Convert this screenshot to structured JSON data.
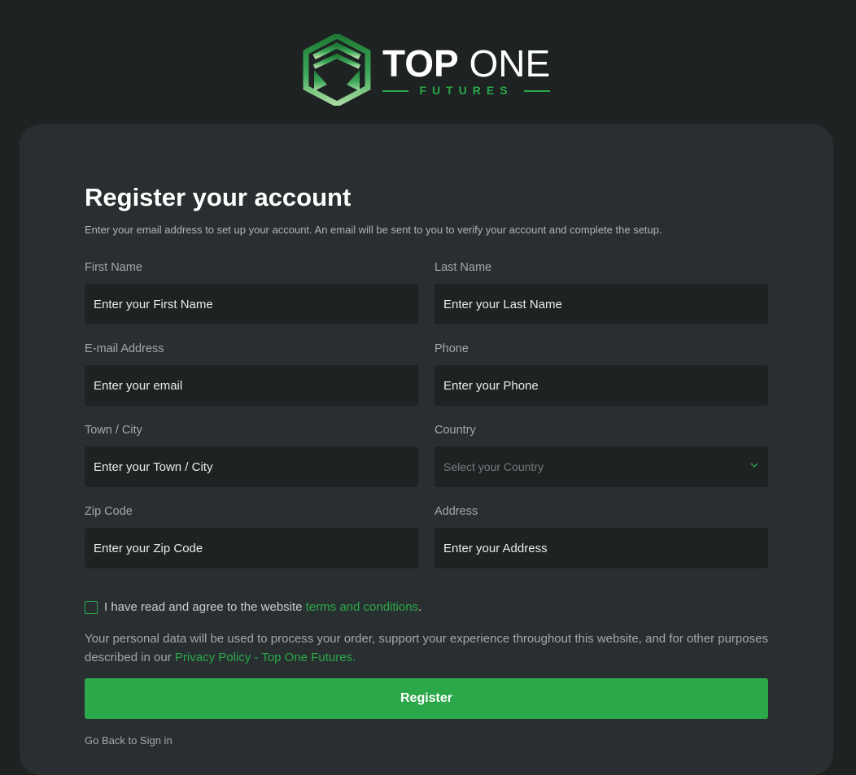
{
  "brand": {
    "name_bold": "TOP",
    "name_light": "ONE",
    "subtitle": "FUTURES",
    "logo_icon": "hexagon-logo-icon",
    "accent_color": "#2ba84a"
  },
  "form": {
    "title": "Register your account",
    "subtitle": "Enter your email address to set up your account. An email will be sent to you to verify your account and complete the setup.",
    "fields": {
      "first_name": {
        "label": "First Name",
        "placeholder": "Enter your First Name"
      },
      "last_name": {
        "label": "Last Name",
        "placeholder": "Enter your Last Name"
      },
      "email": {
        "label": "E-mail Address",
        "placeholder": "Enter your email"
      },
      "phone": {
        "label": "Phone",
        "placeholder": "Enter your Phone"
      },
      "town_city": {
        "label": "Town / City",
        "placeholder": "Enter your Town / City"
      },
      "country": {
        "label": "Country",
        "placeholder": "Select your Country",
        "icon": "chevron-down-icon"
      },
      "zip_code": {
        "label": "Zip Code",
        "placeholder": "Enter your Zip Code"
      },
      "address": {
        "label": "Address",
        "placeholder": "Enter your Address"
      }
    },
    "terms": {
      "prefix": "I have read and agree to the website ",
      "link": "terms and conditions",
      "suffix": ".",
      "checked": false
    },
    "privacy": {
      "text": "Your personal data will be used to process your order, support your experience throughout this website, and for other purposes described in our ",
      "link": "Privacy Policy - Top One Futures."
    },
    "register_label": "Register",
    "back_label": "Go Back to Sign in"
  }
}
